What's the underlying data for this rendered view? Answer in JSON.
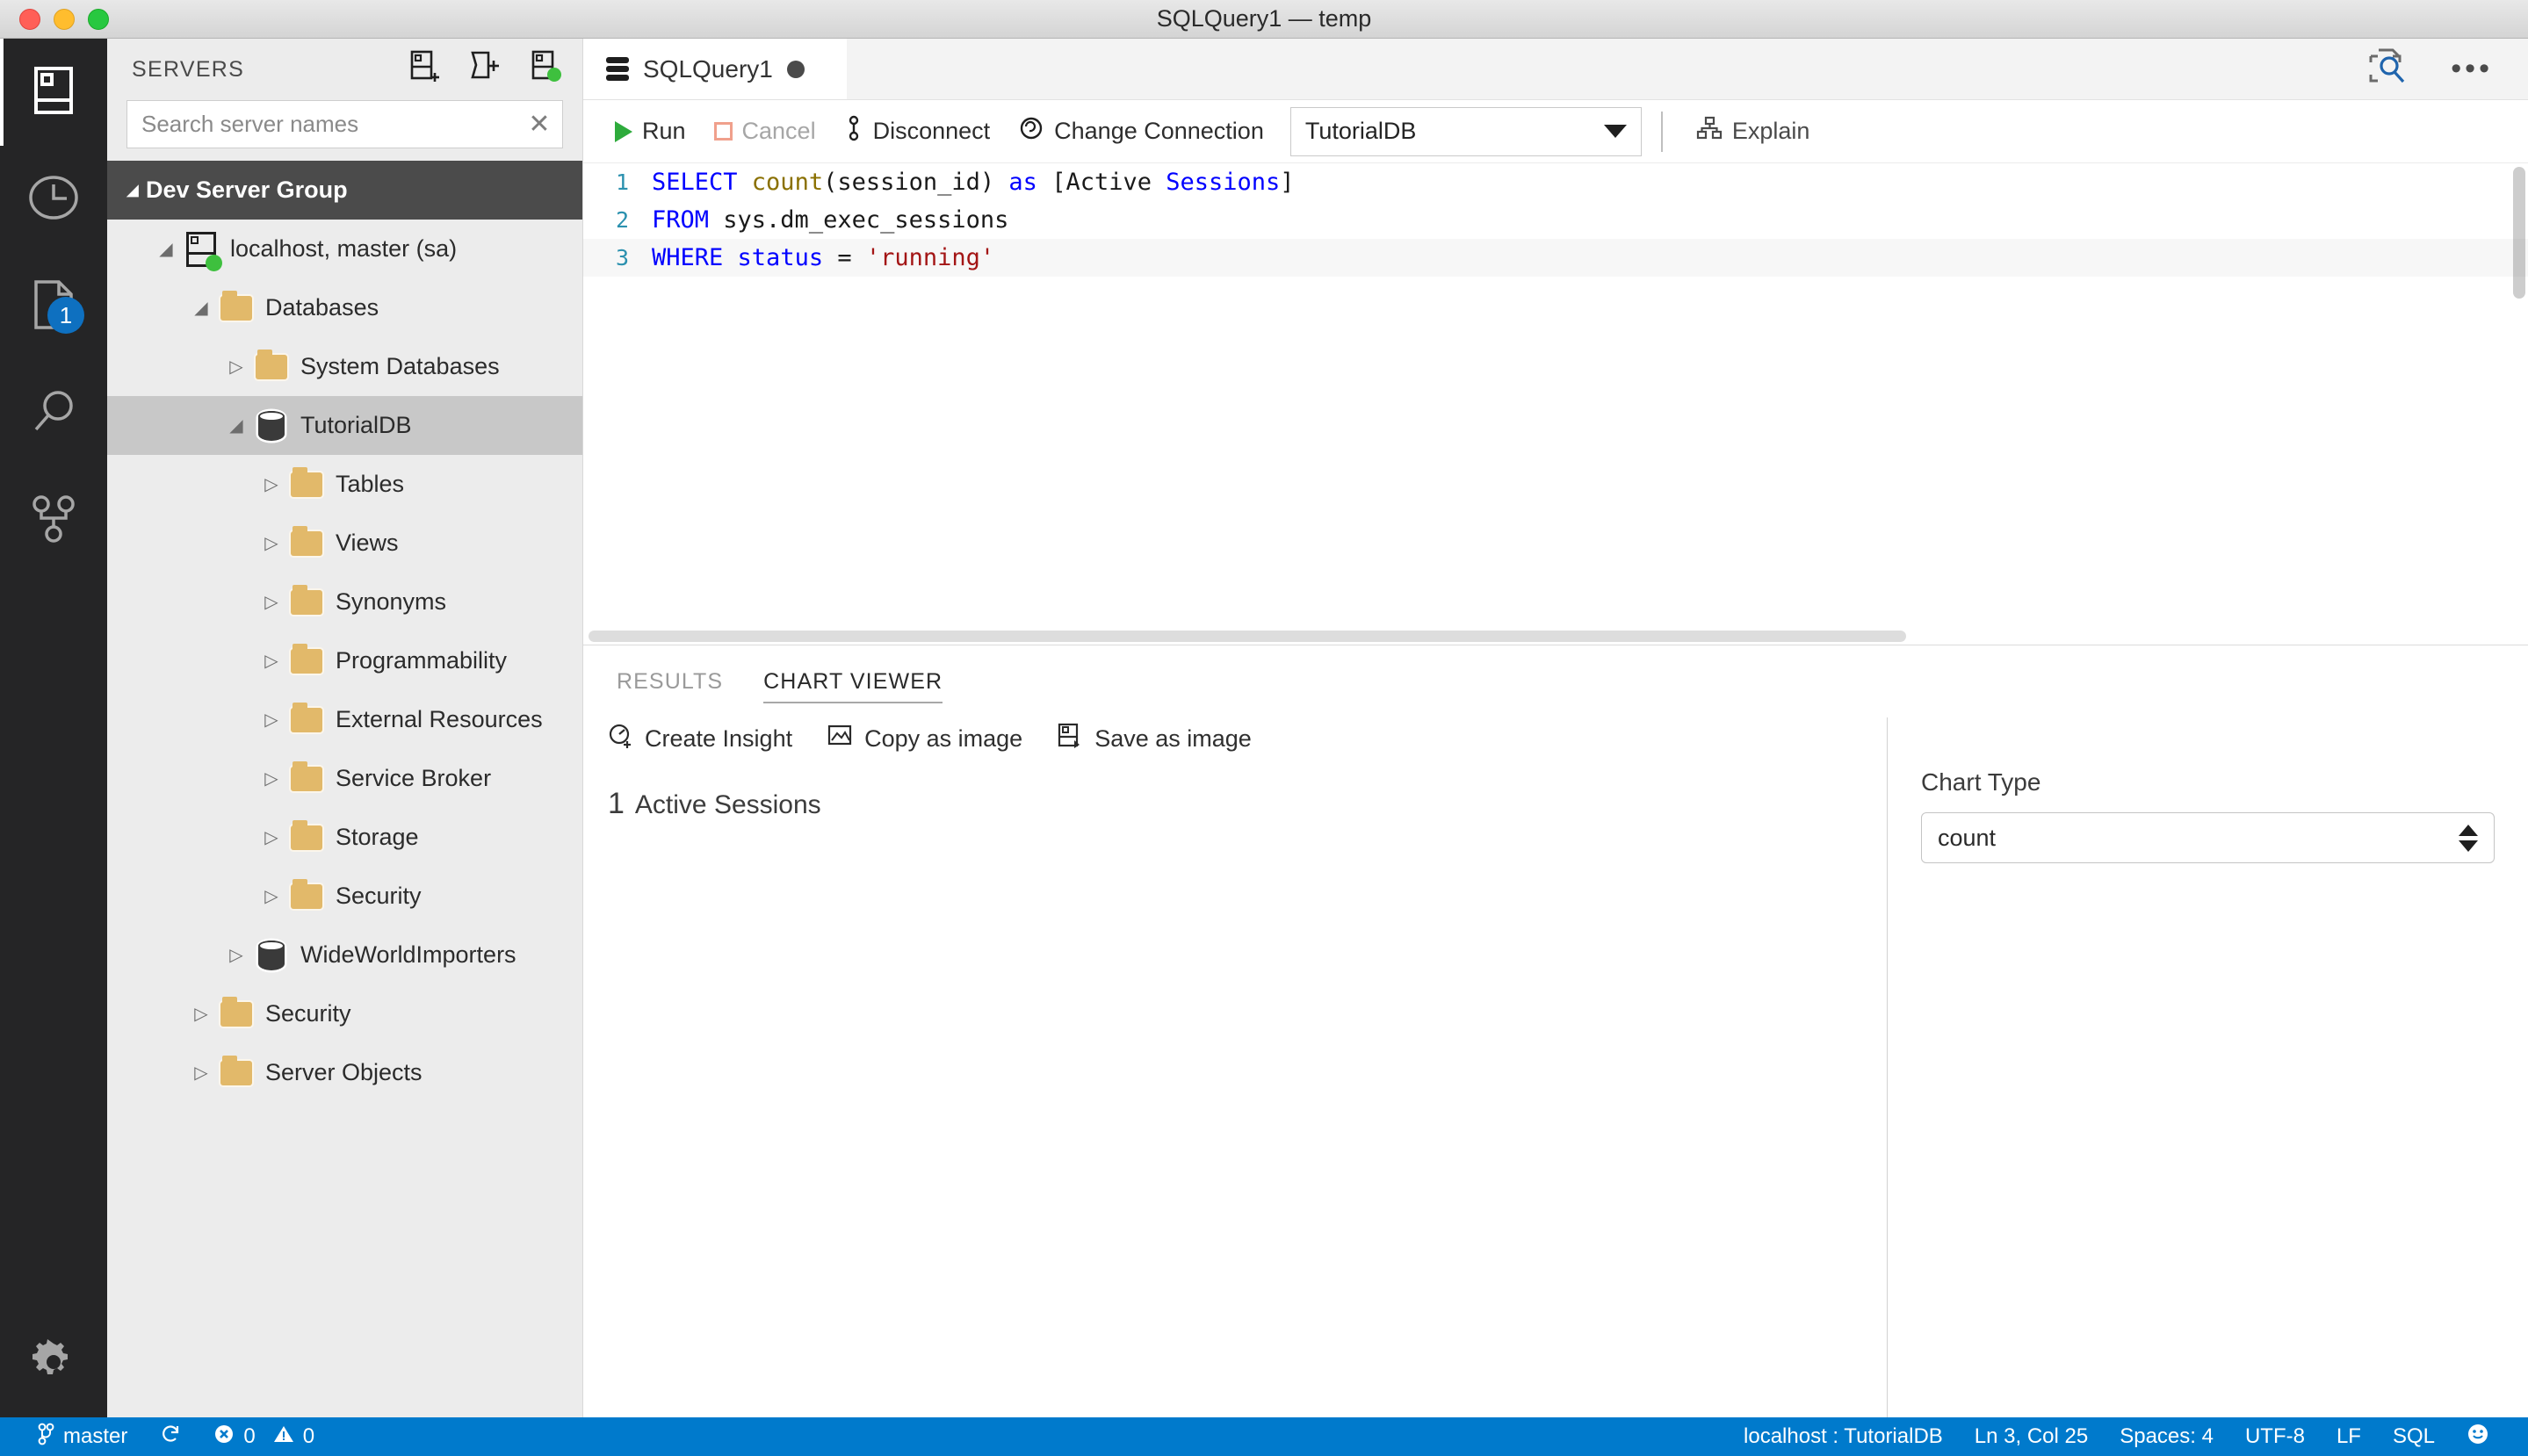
{
  "window": {
    "title": "SQLQuery1 — temp",
    "traffic_lights": [
      "close",
      "minimize",
      "zoom"
    ]
  },
  "activity_bar": {
    "items": [
      {
        "name": "servers",
        "icon": "server-icon",
        "active": true,
        "badge": ""
      },
      {
        "name": "history",
        "icon": "clock-icon",
        "active": false,
        "badge": ""
      },
      {
        "name": "tasks",
        "icon": "file-icon",
        "active": false,
        "badge": "1"
      },
      {
        "name": "search",
        "icon": "search-icon",
        "active": false,
        "badge": ""
      },
      {
        "name": "source-control",
        "icon": "source-control-icon",
        "active": false,
        "badge": ""
      }
    ],
    "bottom": {
      "name": "manage",
      "icon": "gear-icon"
    }
  },
  "sidebar": {
    "title": "SERVERS",
    "actions": [
      {
        "name": "new-connection",
        "icon": "add-server-icon"
      },
      {
        "name": "new-server-group",
        "icon": "add-folder-icon"
      },
      {
        "name": "refresh-servers",
        "icon": "server-connected-icon"
      }
    ],
    "search": {
      "placeholder": "Search server names",
      "value": "",
      "clear": "✕"
    },
    "tree": [
      {
        "label": "Dev Server Group",
        "level": 0,
        "twisty": "open",
        "icon": "none",
        "state": "group"
      },
      {
        "label": "localhost, master (sa)",
        "level": 1,
        "twisty": "open",
        "icon": "server",
        "state": "normal"
      },
      {
        "label": "Databases",
        "level": 2,
        "twisty": "open",
        "icon": "folder",
        "state": "normal"
      },
      {
        "label": "System Databases",
        "level": 3,
        "twisty": "closed",
        "icon": "folder",
        "state": "normal"
      },
      {
        "label": "TutorialDB",
        "level": 3,
        "twisty": "open",
        "icon": "database",
        "state": "selected"
      },
      {
        "label": "Tables",
        "level": 4,
        "twisty": "closed",
        "icon": "folder",
        "state": "normal"
      },
      {
        "label": "Views",
        "level": 4,
        "twisty": "closed",
        "icon": "folder",
        "state": "normal"
      },
      {
        "label": "Synonyms",
        "level": 4,
        "twisty": "closed",
        "icon": "folder",
        "state": "normal"
      },
      {
        "label": "Programmability",
        "level": 4,
        "twisty": "closed",
        "icon": "folder",
        "state": "normal"
      },
      {
        "label": "External Resources",
        "level": 4,
        "twisty": "closed",
        "icon": "folder",
        "state": "normal"
      },
      {
        "label": "Service Broker",
        "level": 4,
        "twisty": "closed",
        "icon": "folder",
        "state": "normal"
      },
      {
        "label": "Storage",
        "level": 4,
        "twisty": "closed",
        "icon": "folder",
        "state": "normal"
      },
      {
        "label": "Security",
        "level": 4,
        "twisty": "closed",
        "icon": "folder",
        "state": "normal"
      },
      {
        "label": "WideWorldImporters",
        "level": 3,
        "twisty": "closed",
        "icon": "database",
        "state": "normal"
      },
      {
        "label": "Security",
        "level": 2,
        "twisty": "closed",
        "icon": "folder",
        "state": "normal"
      },
      {
        "label": "Server Objects",
        "level": 2,
        "twisty": "closed",
        "icon": "folder",
        "state": "normal"
      }
    ]
  },
  "editor": {
    "tab": {
      "label": "SQLQuery1",
      "icon": "database-icon",
      "dirty": true
    },
    "tab_actions": [
      {
        "name": "peek-definition",
        "icon": "find-in-document-icon"
      },
      {
        "name": "more-actions",
        "icon": "ellipsis-icon",
        "glyph": "•••"
      }
    ],
    "toolbar": {
      "run_label": "Run",
      "cancel_label": "Cancel",
      "disconnect_label": "Disconnect",
      "change_connection_label": "Change Connection",
      "database_value": "TutorialDB",
      "explain_label": "Explain"
    },
    "lines": [
      {
        "no": "1",
        "tokens": [
          {
            "t": "SELECT ",
            "c": "kw"
          },
          {
            "t": "count",
            "c": "fn"
          },
          {
            "t": "(session_id) ",
            "c": "pl"
          },
          {
            "t": "as ",
            "c": "kw"
          },
          {
            "t": "[Active ",
            "c": "pl"
          },
          {
            "t": "Sessions",
            "c": "kw"
          },
          {
            "t": "]",
            "c": "pl"
          }
        ]
      },
      {
        "no": "2",
        "tokens": [
          {
            "t": "FROM ",
            "c": "kw"
          },
          {
            "t": "sys.dm_exec_sessions",
            "c": "pl"
          }
        ]
      },
      {
        "no": "3",
        "current": true,
        "tokens": [
          {
            "t": "WHERE ",
            "c": "kw"
          },
          {
            "t": "status ",
            "c": "kw"
          },
          {
            "t": "= ",
            "c": "pl"
          },
          {
            "t": "'running'",
            "c": "str"
          }
        ]
      }
    ]
  },
  "panel": {
    "tabs": [
      {
        "label": "RESULTS",
        "active": false
      },
      {
        "label": "CHART VIEWER",
        "active": true
      }
    ],
    "actions": [
      {
        "label": "Create Insight",
        "icon": "insight-icon"
      },
      {
        "label": "Copy as image",
        "icon": "copy-image-icon"
      },
      {
        "label": "Save as image",
        "icon": "save-image-icon"
      }
    ],
    "chart_side": {
      "label": "Chart Type",
      "selected": "count"
    }
  },
  "chart_data": {
    "type": "table",
    "title": "",
    "columns": [
      "Active Sessions"
    ],
    "rows": [
      [
        "1"
      ]
    ],
    "value": "1",
    "value_label": "Active Sessions",
    "chart_type_selected": "count"
  },
  "status_bar": {
    "branch": "master",
    "branch_icon": "source-control-icon",
    "sync_icon": "sync-icon",
    "errors_icon": "error-icon",
    "errors": "0",
    "warnings_icon": "warning-icon",
    "warnings": "0",
    "connection": "localhost : TutorialDB",
    "cursor": "Ln 3, Col 25",
    "spaces": "Spaces: 4",
    "encoding": "UTF-8",
    "eol": "LF",
    "language": "SQL",
    "feedback_icon": "smiley-icon"
  },
  "colors": {
    "accent": "#007acc",
    "selection": "#c8c8c8",
    "group_header": "#4b4b4b",
    "folder": "#e2b96a",
    "led_green": "#3ec03e",
    "keyword": "#0000ff",
    "string": "#a31515",
    "function": "#8a7000",
    "linenum": "#2b91af"
  }
}
